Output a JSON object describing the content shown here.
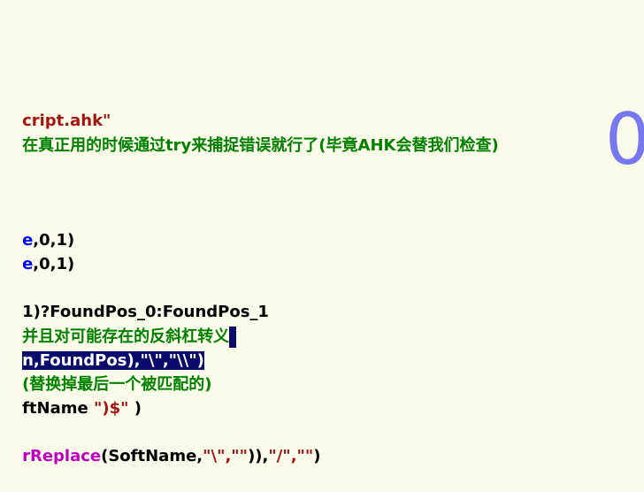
{
  "editor": {
    "lines": {
      "l1": "cript.ahk\"",
      "l2": "在真正用的时候通过try来捕捉错误就行了(毕竟AHK会替我们检查)",
      "l3_kw": "e",
      "l3_rest": ",0,1)",
      "l4_kw": "e",
      "l4_rest": ",0,1)",
      "l5": "1)?FoundPos_0:FoundPos_1",
      "l6": "并且对可能存在的反斜杠转义",
      "l7": "n,FoundPos),\"\\\",\"\\\\\")",
      "l8": "(替换掉最后一个被匹配的)",
      "l9_a": "ftName ",
      "l9_str": "\")$\"",
      "l9_b": " )",
      "l10_fn": "rReplace",
      "l10_a": "(SoftName,",
      "l10_s1": "\"\\\",\"\"",
      "l10_b": ")),",
      "l10_s2": "\"/\",\"\"",
      "l10_c": ")"
    },
    "side_glyph": "0"
  },
  "colors": {
    "background": "#fbfbe9",
    "string": "#a31515",
    "comment": "#008000",
    "keyword": "#0000ff",
    "function": "#c000c0",
    "selection": "#0b0b6b"
  }
}
